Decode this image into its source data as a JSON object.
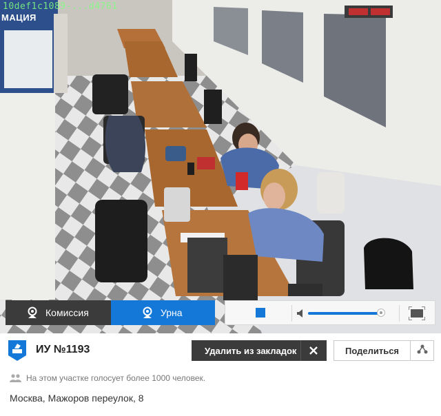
{
  "video": {
    "stream_id": "10def1c1089-...d4761",
    "poster_text": "МАЦИЯ"
  },
  "camera_tabs": [
    {
      "label": "Комиссия",
      "active": false
    },
    {
      "label": "Урна",
      "active": true
    }
  ],
  "player": {
    "volume_level": 0.95,
    "icons": [
      "stop-icon",
      "volume-icon",
      "fullscreen-icon"
    ]
  },
  "station": {
    "title": "ИУ №1193",
    "bookmark_label": "Удалить из закладок",
    "share_label": "Поделиться",
    "voters_text": "На этом участке голосует более 1000 человек.",
    "address": "Москва, Мажоров переулок, 8"
  },
  "colors": {
    "accent": "#1378d8",
    "dark_button": "#3b3b3b",
    "muted_text": "#777777"
  }
}
